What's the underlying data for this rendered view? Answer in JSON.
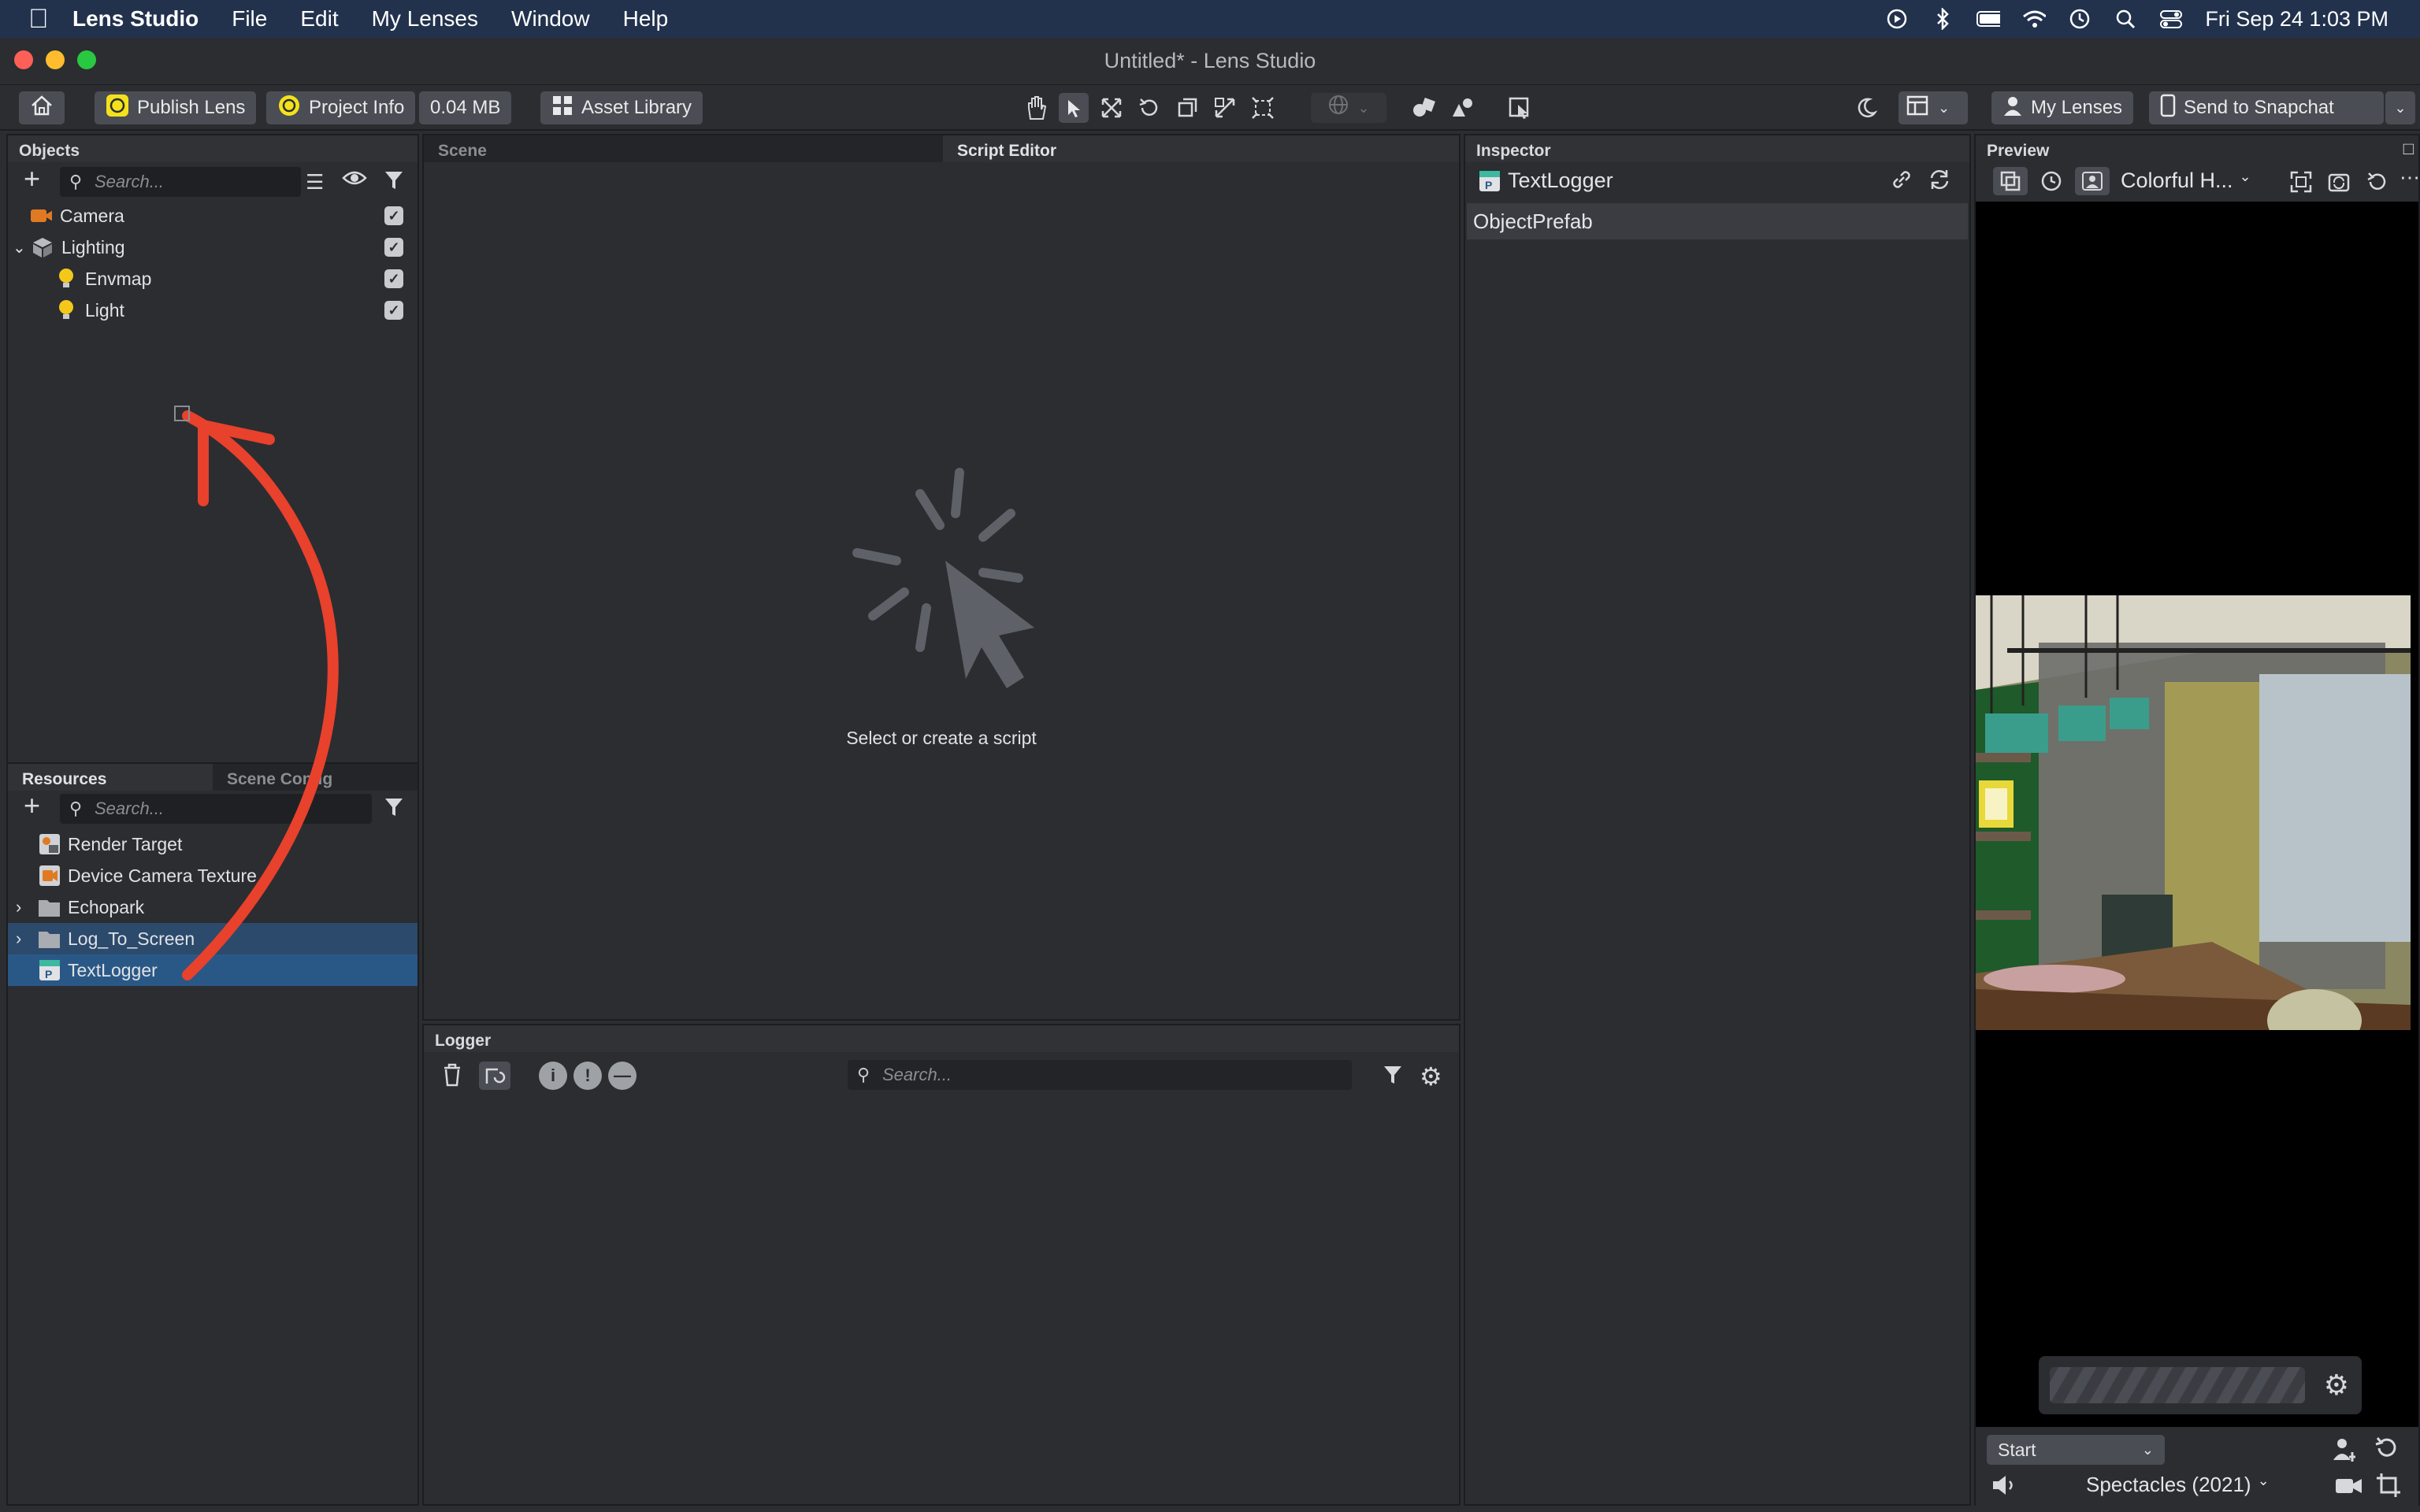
{
  "menubar": {
    "app_name": "Lens Studio",
    "items": [
      "File",
      "Edit",
      "My Lenses",
      "Window",
      "Help"
    ],
    "datetime": "Fri Sep 24  1:03 PM"
  },
  "window": {
    "title": "Untitled* - Lens Studio"
  },
  "toolbar": {
    "publish_lens": "Publish Lens",
    "project_info": "Project Info",
    "size": "0.04 MB",
    "asset_library": "Asset Library",
    "my_lenses": "My Lenses",
    "send_to_snapchat": "Send to Snapchat"
  },
  "objects_panel": {
    "title": "Objects",
    "search_placeholder": "Search...",
    "items": [
      {
        "label": "Camera",
        "icon": "camera-icon",
        "checked": true
      },
      {
        "label": "Lighting",
        "icon": "lighting-icon",
        "checked": true
      },
      {
        "label": "Envmap",
        "icon": "bulb-icon",
        "checked": true
      },
      {
        "label": "Light",
        "icon": "bulb-icon",
        "checked": true
      }
    ]
  },
  "resources_panel": {
    "tabs": [
      "Resources",
      "Scene Config"
    ],
    "search_placeholder": "Search...",
    "items": [
      {
        "label": "Render Target",
        "icon": "render-target-icon"
      },
      {
        "label": "Device Camera Texture",
        "icon": "device-camera-texture-icon"
      },
      {
        "label": "Echopark",
        "icon": "folder-icon"
      },
      {
        "label": "Log_To_Screen",
        "icon": "folder-icon"
      },
      {
        "label": "TextLogger",
        "icon": "prefab-icon"
      }
    ]
  },
  "center": {
    "tabs": [
      "Scene",
      "Script Editor"
    ],
    "empty_message": "Select or create a script"
  },
  "logger": {
    "title": "Logger",
    "search_placeholder": "Search..."
  },
  "inspector": {
    "title": "Inspector",
    "object_name": "TextLogger",
    "component": "ObjectPrefab"
  },
  "preview": {
    "title": "Preview",
    "lens_dropdown": "Colorful H...",
    "start_dropdown": "Start",
    "device": "Spectacles (2021)"
  },
  "colors": {
    "accent_selection": "#2a5886",
    "annotation_arrow": "#e8412c",
    "menubar": "#22324d"
  }
}
